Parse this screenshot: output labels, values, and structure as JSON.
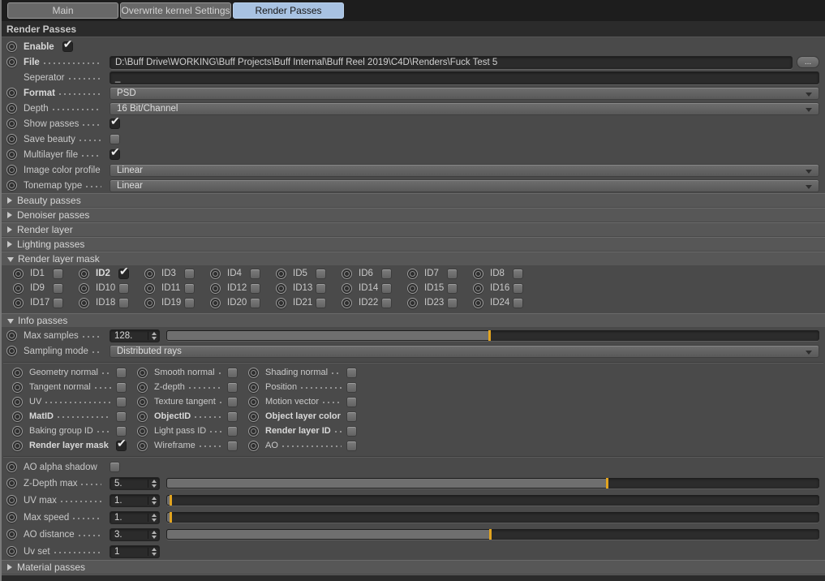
{
  "colors": {
    "accent_yellow": "#e2a41f",
    "tab_active_blue": "#a8c2e2",
    "background": "#4a4a4a"
  },
  "tabs": {
    "items": [
      {
        "label": "Main",
        "active": false
      },
      {
        "label": "Overwrite kernel Settings",
        "active": false
      },
      {
        "label": "Render Passes",
        "active": true
      }
    ]
  },
  "header": {
    "title": "Render Passes"
  },
  "settings": {
    "enable": {
      "label": "Enable",
      "checked": true,
      "bold": true
    },
    "file": {
      "label": "File",
      "bold": true,
      "value": "D:\\Buff Drive\\WORKING\\Buff Projects\\Buff Internal\\Buff Reel 2019\\C4D\\Renders\\Fuck Test 5",
      "browse_label": "..."
    },
    "seperator": {
      "label": "Seperator",
      "value": "_"
    },
    "format": {
      "label": "Format",
      "bold": true,
      "value": "PSD"
    },
    "depth": {
      "label": "Depth",
      "value": "16 Bit/Channel"
    },
    "show_passes": {
      "label": "Show passes",
      "checked": true
    },
    "save_beauty": {
      "label": "Save beauty",
      "checked": false
    },
    "multilayer_file": {
      "label": "Multilayer file",
      "checked": true
    },
    "image_color_profile": {
      "label": "Image color profile",
      "value": "Linear"
    },
    "tonemap_type": {
      "label": "Tonemap type",
      "value": "Linear"
    }
  },
  "sections": {
    "beauty": {
      "title": "Beauty passes",
      "expanded": false
    },
    "denoiser": {
      "title": "Denoiser passes",
      "expanded": false
    },
    "render_layer": {
      "title": "Render layer",
      "expanded": false
    },
    "lighting": {
      "title": "Lighting passes",
      "expanded": false
    },
    "material": {
      "title": "Material passes",
      "expanded": false
    }
  },
  "mask": {
    "title": "Render layer mask",
    "expanded": true,
    "ids": [
      {
        "label": "ID1",
        "checked": false
      },
      {
        "label": "ID2",
        "checked": true,
        "bold": true
      },
      {
        "label": "ID3",
        "checked": false
      },
      {
        "label": "ID4",
        "checked": false
      },
      {
        "label": "ID5",
        "checked": false
      },
      {
        "label": "ID6",
        "checked": false
      },
      {
        "label": "ID7",
        "checked": false
      },
      {
        "label": "ID8",
        "checked": false
      },
      {
        "label": "ID9",
        "checked": false
      },
      {
        "label": "ID10",
        "checked": false
      },
      {
        "label": "ID11",
        "checked": false
      },
      {
        "label": "ID12",
        "checked": false
      },
      {
        "label": "ID13",
        "checked": false
      },
      {
        "label": "ID14",
        "checked": false
      },
      {
        "label": "ID15",
        "checked": false
      },
      {
        "label": "ID16",
        "checked": false
      },
      {
        "label": "ID17",
        "checked": false
      },
      {
        "label": "ID18",
        "checked": false
      },
      {
        "label": "ID19",
        "checked": false
      },
      {
        "label": "ID20",
        "checked": false
      },
      {
        "label": "ID21",
        "checked": false
      },
      {
        "label": "ID22",
        "checked": false
      },
      {
        "label": "ID23",
        "checked": false
      },
      {
        "label": "ID24",
        "checked": false
      }
    ]
  },
  "info": {
    "title": "Info passes",
    "expanded": true,
    "max_samples": {
      "label": "Max samples",
      "value": "128.",
      "slider_fraction": 0.495
    },
    "sampling_mode": {
      "label": "Sampling mode",
      "value": "Distributed rays"
    },
    "passes": [
      {
        "label": "Geometry normal",
        "checked": false
      },
      {
        "label": "Smooth normal",
        "checked": false
      },
      {
        "label": "Shading normal",
        "checked": false
      },
      {
        "label": "Tangent normal",
        "checked": false
      },
      {
        "label": "Z-depth",
        "checked": false
      },
      {
        "label": "Position",
        "checked": false
      },
      {
        "label": "UV",
        "checked": false
      },
      {
        "label": "Texture tangent",
        "checked": false
      },
      {
        "label": "Motion vector",
        "checked": false
      },
      {
        "label": "MatID",
        "checked": false,
        "bold": true
      },
      {
        "label": "ObjectID",
        "checked": false,
        "bold": true
      },
      {
        "label": "Object layer color",
        "checked": false,
        "bold": true
      },
      {
        "label": "Baking group ID",
        "checked": false
      },
      {
        "label": "Light pass ID",
        "checked": false
      },
      {
        "label": "Render layer ID",
        "checked": false,
        "bold": true
      },
      {
        "label": "Render layer mask",
        "checked": true,
        "bold": true
      },
      {
        "label": "Wireframe",
        "checked": false
      },
      {
        "label": "AO",
        "checked": false
      }
    ],
    "ao_alpha_shadow": {
      "label": "AO alpha shadow",
      "checked": false
    },
    "z_depth_max": {
      "label": "Z-Depth max",
      "value": "5.",
      "slider_fraction": 0.674
    },
    "uv_max": {
      "label": "UV max",
      "value": "1.",
      "slider_fraction": 0.006
    },
    "max_speed": {
      "label": "Max speed",
      "value": "1.",
      "slider_fraction": 0.006
    },
    "ao_distance": {
      "label": "AO distance",
      "value": "3.",
      "slider_fraction": 0.496
    },
    "uv_set": {
      "label": "Uv set",
      "value": "1"
    }
  }
}
